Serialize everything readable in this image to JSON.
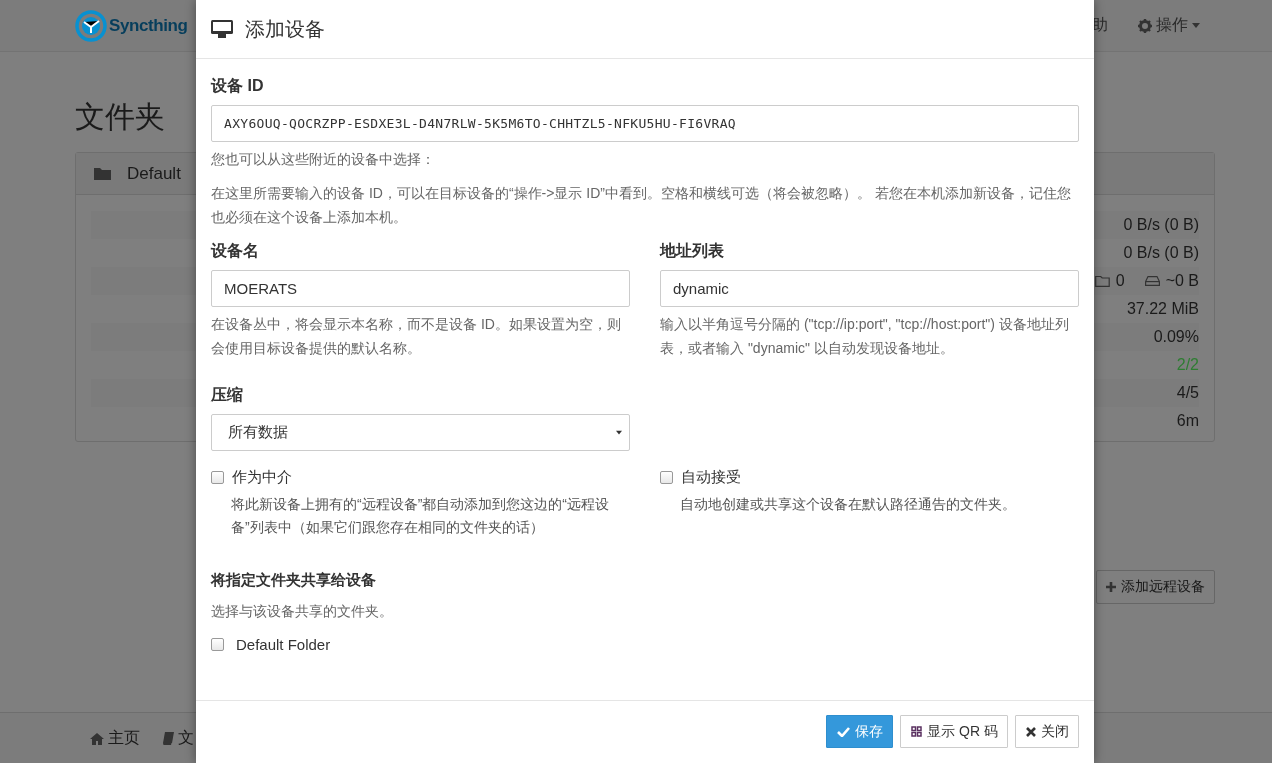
{
  "navbar": {
    "brand": "Syncthing",
    "links": [
      {
        "kind": "text",
        "label": "助"
      },
      {
        "kind": "menu",
        "label": "操作"
      }
    ]
  },
  "heading": "文件夹",
  "folder_panel": {
    "name": "Default",
    "stats": [
      {
        "kind": "text",
        "value": "0 B/s (0 B)",
        "color": "#1a1a1a"
      },
      {
        "kind": "text",
        "value": "0 B/s (0 B)",
        "color": "#1a1a1a"
      },
      {
        "kind": "counts",
        "files": "0",
        "size": "~0 B"
      },
      {
        "kind": "text",
        "value": "37.22 MiB",
        "color": "#1a1a1a"
      },
      {
        "kind": "text",
        "value": "0.09%",
        "color": "#1a1a1a"
      },
      {
        "kind": "text",
        "value": "2/2",
        "color": "#2e7d32"
      },
      {
        "kind": "text",
        "value": "4/5",
        "color": "#1a1a1a"
      },
      {
        "kind": "text",
        "value": "6m",
        "color": "#1a1a1a"
      }
    ]
  },
  "add_remote_button": "添加远程设备",
  "footer_links": [
    {
      "kind": "home",
      "label": "主页"
    },
    {
      "kind": "book",
      "label": "文"
    }
  ],
  "dialog": {
    "title": "添加设备",
    "device_id": {
      "label": "设备 ID",
      "value": "AXY6OUQ-QOCRZPP-ESDXE3L-D4N7RLW-5K5M6TO-CHHTZL5-NFKU5HU-FI6VRAQ"
    },
    "nearby_hint": "您也可以从这些附近的设备中选择：",
    "id_help": "在这里所需要输入的设备 ID，可以在目标设备的“操作->显示 ID”中看到。空格和横线可选（将会被忽略）。 若您在本机添加新设备，记住您也必须在这个设备上添加本机。",
    "device_name": {
      "label": "设备名",
      "value": "MOERATS",
      "help": "在设备丛中，将会显示本名称，而不是设备 ID。如果设置为空，则会使用目标设备提供的默认名称。"
    },
    "addresses": {
      "label": "地址列表",
      "value": "dynamic",
      "help": "输入以半角逗号分隔的 (\"tcp://ip:port\", \"tcp://host:port\") 设备地址列表，或者输入 \"dynamic\" 以自动发现设备地址。"
    },
    "compression": {
      "label": "压缩",
      "value": "所有数据"
    },
    "options": [
      {
        "label": "作为中介",
        "checked": false,
        "help": "将此新设备上拥有的“远程设备”都自动添加到您这边的“远程设备”列表中（如果它们跟您存在相同的文件夹的话）"
      },
      {
        "label": "自动接受",
        "checked": false,
        "help": "自动地创建或共享这个设备在默认路径通告的文件夹。"
      }
    ],
    "share": {
      "heading": "将指定文件夹共享给设备",
      "hint": "选择与该设备共享的文件夹。",
      "folders": [
        {
          "label": "Default Folder",
          "checked": false
        }
      ]
    },
    "buttons": [
      {
        "kind": "save",
        "label": "保存"
      },
      {
        "kind": "qr",
        "label": "显示 QR 码"
      },
      {
        "kind": "close",
        "label": "关闭"
      }
    ]
  }
}
